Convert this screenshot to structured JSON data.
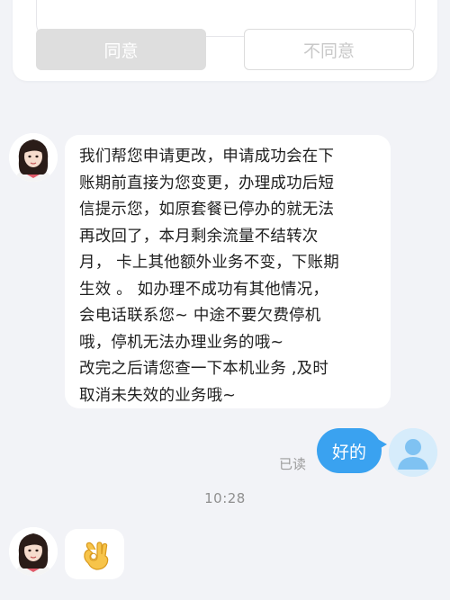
{
  "consent": {
    "agree_label": "同意",
    "disagree_label": "不同意"
  },
  "agent_message": {
    "lines": [
      "我们帮您申请更改，申请成功会在下",
      "账期前直接为您变更，办理成功后短",
      "信提示您，如原套餐已停办的就无法",
      "再改回了，本月剩余流量不结转次",
      "月，  卡上其他额外业务不变，下账期",
      "生效 。   如办理不成功有其他情况，",
      "会电话联系您~  中途不要欠费停机",
      "哦，停机无法办理业务的哦~",
      "改完之后请您查一下本机业务 ,及时",
      "取消未失效的业务哦~"
    ]
  },
  "user_message": {
    "text": "好的",
    "read_status": "已读"
  },
  "timestamp": "10:28",
  "agent_reply": {
    "emoji": "ok-hand-icon"
  },
  "colors": {
    "background": "#f2f3f7",
    "user_bubble": "#3aa2f0",
    "agree_button": "#dedede"
  }
}
